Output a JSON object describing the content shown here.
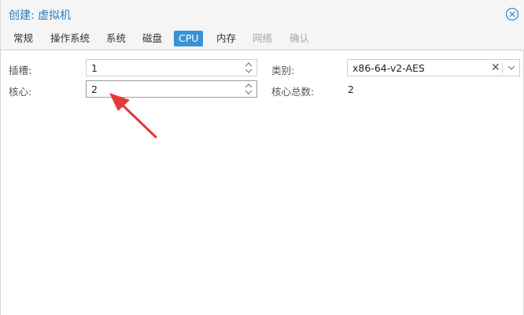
{
  "window": {
    "title": "创建: 虚拟机"
  },
  "tabs": [
    {
      "label": "常规",
      "state": "normal"
    },
    {
      "label": "操作系统",
      "state": "normal"
    },
    {
      "label": "系统",
      "state": "normal"
    },
    {
      "label": "磁盘",
      "state": "normal"
    },
    {
      "label": "CPU",
      "state": "active"
    },
    {
      "label": "内存",
      "state": "normal"
    },
    {
      "label": "网络",
      "state": "disabled"
    },
    {
      "label": "确认",
      "state": "disabled"
    }
  ],
  "form": {
    "sockets": {
      "label": "插槽:",
      "value": "1"
    },
    "cores": {
      "label": "核心:",
      "value": "2"
    },
    "type": {
      "label": "类别:",
      "value": "x86-64-v2-AES"
    },
    "total_cores": {
      "label": "核心总数:",
      "value": "2"
    }
  },
  "colors": {
    "accent": "#3892d4",
    "title": "#2b7bb9",
    "annotation_arrow": "#e53935"
  }
}
